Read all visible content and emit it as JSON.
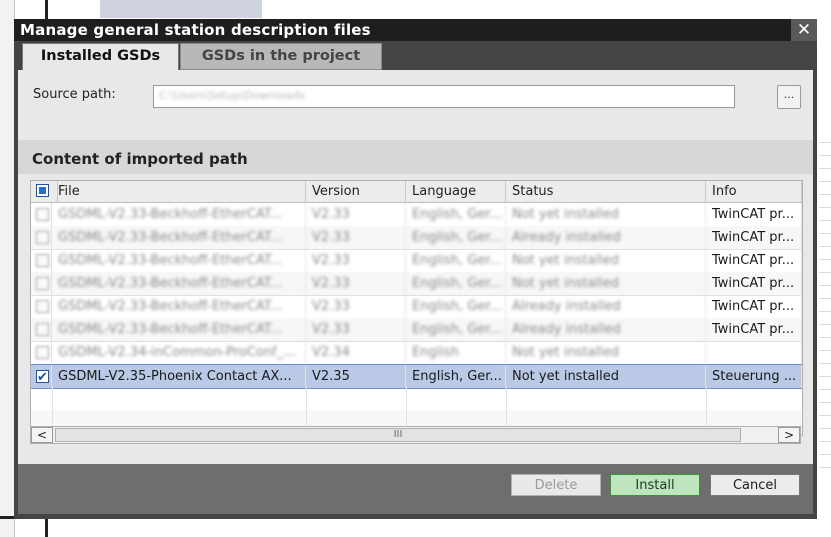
{
  "window": {
    "title": "Manage general station description files",
    "close_glyph": "✕"
  },
  "tabs": [
    {
      "label": "Installed GSDs",
      "active": true
    },
    {
      "label": "GSDs in the project",
      "active": false
    }
  ],
  "source": {
    "label": "Source path:",
    "value": "C:\\Users\\Setup\\Downloads",
    "browse_label": "..."
  },
  "section_title": "Content of imported path",
  "table": {
    "columns": [
      "File",
      "Version",
      "Language",
      "Status",
      "Info"
    ],
    "rows": [
      {
        "file": "GSDML-V2.33-Beckhoff-EtherCAT...",
        "version": "V2.33",
        "language": "English, Ger...",
        "status": "Not yet installed",
        "info": "TwinCAT pr...",
        "checked": false,
        "blurred": true,
        "selected": false
      },
      {
        "file": "GSDML-V2.33-Beckhoff-EtherCAT...",
        "version": "V2.33",
        "language": "English, Ger...",
        "status": "Already installed",
        "info": "TwinCAT pr...",
        "checked": false,
        "blurred": true,
        "selected": false
      },
      {
        "file": "GSDML-V2.33-Beckhoff-EtherCAT...",
        "version": "V2.33",
        "language": "English, Ger...",
        "status": "Not yet installed",
        "info": "TwinCAT pr...",
        "checked": false,
        "blurred": true,
        "selected": false
      },
      {
        "file": "GSDML-V2.33-Beckhoff-EtherCAT...",
        "version": "V2.33",
        "language": "English, Ger...",
        "status": "Not yet installed",
        "info": "TwinCAT pr...",
        "checked": false,
        "blurred": true,
        "selected": false
      },
      {
        "file": "GSDML-V2.33-Beckhoff-EtherCAT...",
        "version": "V2.33",
        "language": "English, Ger...",
        "status": "Already installed",
        "info": "TwinCAT pr...",
        "checked": false,
        "blurred": true,
        "selected": false
      },
      {
        "file": "GSDML-V2.33-Beckhoff-EtherCAT...",
        "version": "V2.33",
        "language": "English, Ger...",
        "status": "Already installed",
        "info": "TwinCAT pr...",
        "checked": false,
        "blurred": true,
        "selected": false
      },
      {
        "file": "GSDML-V2.34-inCommon-ProConf_...",
        "version": "V2.34",
        "language": "English",
        "status": "Not yet installed",
        "info": "",
        "checked": false,
        "blurred": true,
        "selected": false
      },
      {
        "file": "GSDML-V2.35-Phoenix Contact AX...",
        "version": "V2.35",
        "language": "English, Ger...",
        "status": "Not yet installed",
        "info": "Steuerung ...",
        "checked": true,
        "blurred": false,
        "selected": true
      }
    ]
  },
  "scrollbar": {
    "left_glyph": "<",
    "thumb_glyph": "III",
    "right_glyph": ">"
  },
  "buttons": {
    "delete": "Delete",
    "install": "Install",
    "cancel": "Cancel"
  },
  "colors": {
    "titlebar": "#1e1e1e",
    "selected_row": "#b9c9e6",
    "install_border": "#2f9a2f"
  }
}
